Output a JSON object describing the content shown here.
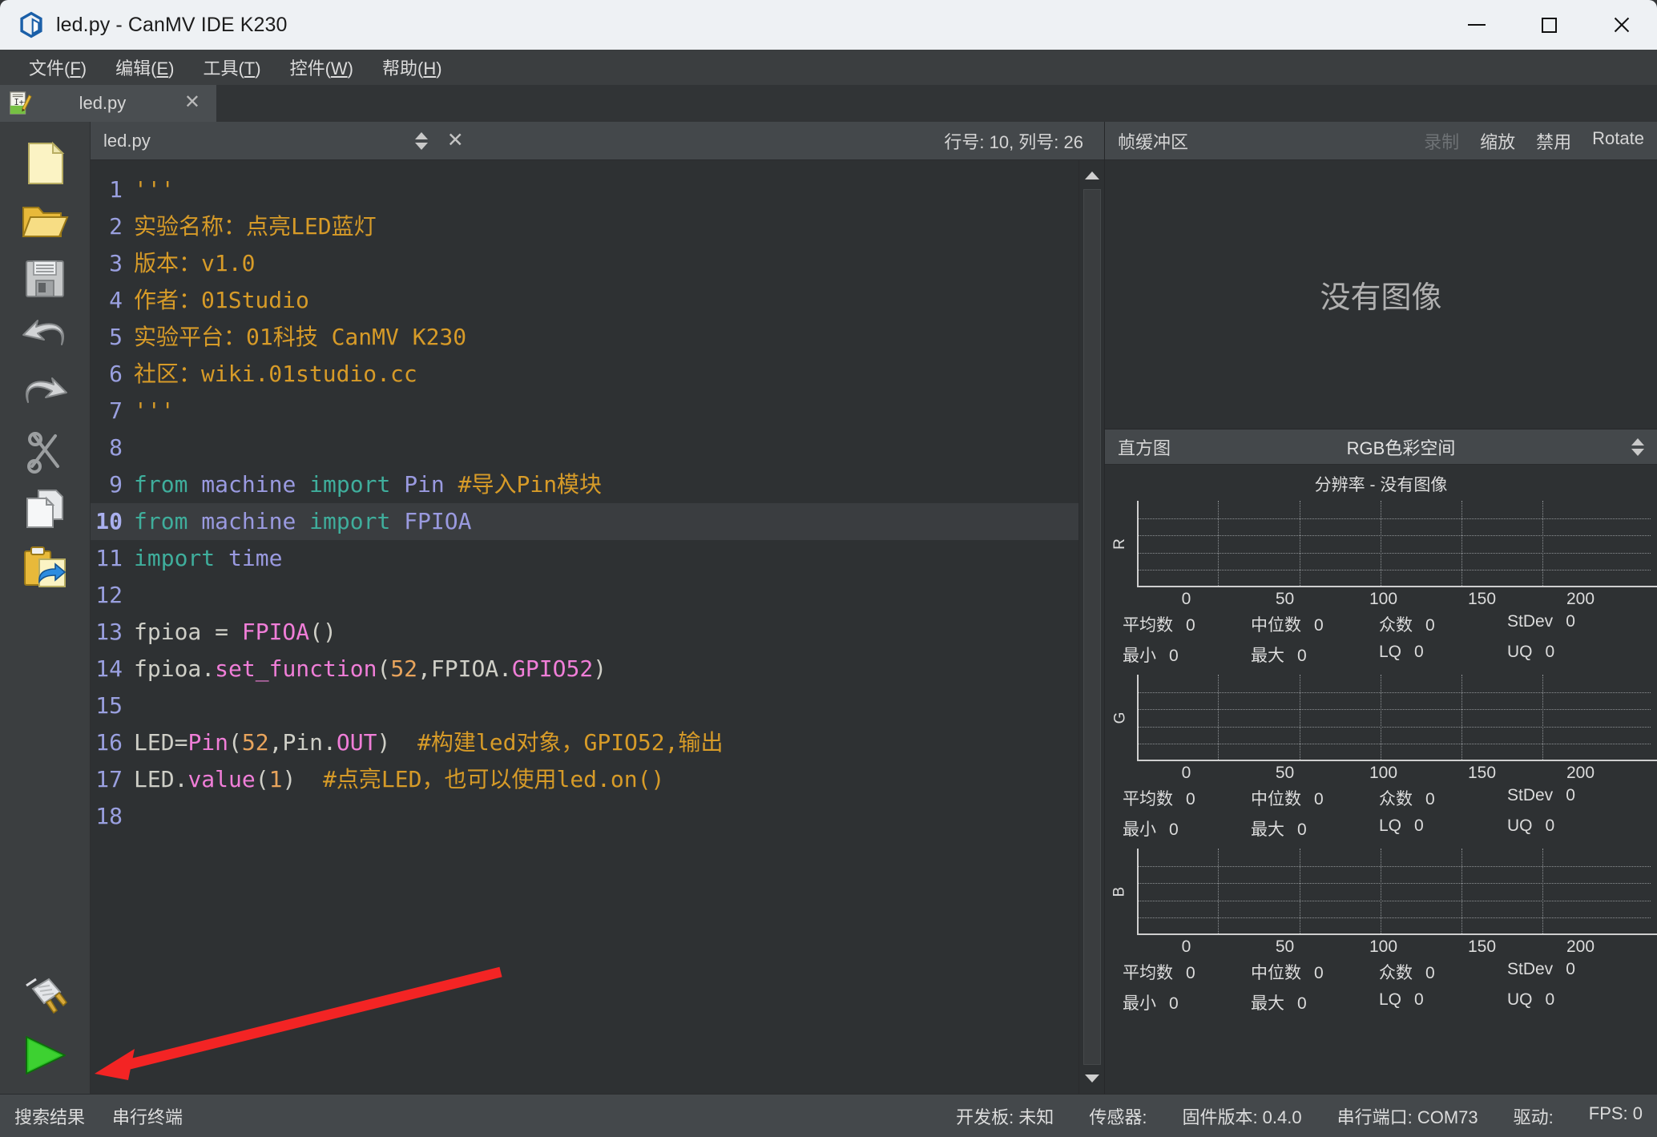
{
  "window": {
    "title": "led.py - CanMV IDE K230",
    "logo_icon": "canmv-hexagon-logo",
    "minimize_label": "minimize",
    "maximize_label": "maximize",
    "close_label": "close"
  },
  "menubar": {
    "items": [
      {
        "label": "文件",
        "accel": "F"
      },
      {
        "label": "编辑",
        "accel": "E"
      },
      {
        "label": "工具",
        "accel": "T"
      },
      {
        "label": "控件",
        "accel": "W"
      },
      {
        "label": "帮助",
        "accel": "H"
      }
    ]
  },
  "file_tabs": [
    {
      "label": "led.py",
      "icon": "python-file-icon",
      "close": "✕"
    }
  ],
  "left_toolbar": {
    "items": [
      {
        "name": "new-file",
        "icon": "new-file-icon"
      },
      {
        "name": "open-file",
        "icon": "open-folder-icon"
      },
      {
        "name": "save-file",
        "icon": "floppy-save-icon"
      },
      {
        "name": "undo",
        "icon": "undo-arrow-icon"
      },
      {
        "name": "redo",
        "icon": "redo-arrow-icon"
      },
      {
        "name": "cut",
        "icon": "scissors-icon"
      },
      {
        "name": "copy",
        "icon": "copy-pages-icon"
      },
      {
        "name": "paste",
        "icon": "paste-clipboard-icon"
      }
    ],
    "bottom_items": [
      {
        "name": "connect",
        "icon": "plug-connect-icon"
      },
      {
        "name": "run",
        "icon": "green-play-icon"
      }
    ]
  },
  "editor": {
    "filename": "led.py",
    "close": "✕",
    "cursor_position": "行号: 10, 列号: 26",
    "current_line": 10,
    "lines": [
      {
        "n": 1,
        "tokens": [
          {
            "t": "str",
            "s": "'''"
          }
        ]
      },
      {
        "n": 2,
        "tokens": [
          {
            "t": "str",
            "s": "实验名称：点亮LED蓝灯"
          }
        ]
      },
      {
        "n": 3,
        "tokens": [
          {
            "t": "str",
            "s": "版本：v1.0"
          }
        ]
      },
      {
        "n": 4,
        "tokens": [
          {
            "t": "str",
            "s": "作者：01Studio"
          }
        ]
      },
      {
        "n": 5,
        "tokens": [
          {
            "t": "str",
            "s": "实验平台：01科技 CanMV K230"
          }
        ]
      },
      {
        "n": 6,
        "tokens": [
          {
            "t": "str",
            "s": "社区：wiki.01studio.cc"
          }
        ]
      },
      {
        "n": 7,
        "tokens": [
          {
            "t": "str",
            "s": "'''"
          }
        ]
      },
      {
        "n": 8,
        "tokens": []
      },
      {
        "n": 9,
        "tokens": [
          {
            "t": "kw",
            "s": "from"
          },
          {
            "t": "pl",
            "s": " "
          },
          {
            "t": "id",
            "s": "machine"
          },
          {
            "t": "pl",
            "s": " "
          },
          {
            "t": "kw",
            "s": "import"
          },
          {
            "t": "pl",
            "s": " "
          },
          {
            "t": "id",
            "s": "Pin"
          },
          {
            "t": "pl",
            "s": " "
          },
          {
            "t": "com",
            "s": "#导入Pin模块"
          }
        ]
      },
      {
        "n": 10,
        "tokens": [
          {
            "t": "kw",
            "s": "from"
          },
          {
            "t": "pl",
            "s": " "
          },
          {
            "t": "id",
            "s": "machine"
          },
          {
            "t": "pl",
            "s": " "
          },
          {
            "t": "kw",
            "s": "import"
          },
          {
            "t": "pl",
            "s": " "
          },
          {
            "t": "id",
            "s": "FPIOA"
          }
        ]
      },
      {
        "n": 11,
        "tokens": [
          {
            "t": "kw",
            "s": "import"
          },
          {
            "t": "pl",
            "s": " "
          },
          {
            "t": "id",
            "s": "time"
          }
        ]
      },
      {
        "n": 12,
        "tokens": []
      },
      {
        "n": 13,
        "tokens": [
          {
            "t": "pl",
            "s": "fpioa = "
          },
          {
            "t": "fn",
            "s": "FPIOA"
          },
          {
            "t": "pl",
            "s": "()"
          }
        ]
      },
      {
        "n": 14,
        "tokens": [
          {
            "t": "pl",
            "s": "fpioa."
          },
          {
            "t": "fn",
            "s": "set_function"
          },
          {
            "t": "pl",
            "s": "("
          },
          {
            "t": "num",
            "s": "52"
          },
          {
            "t": "pl",
            "s": ",FPIOA."
          },
          {
            "t": "fn",
            "s": "GPIO52"
          },
          {
            "t": "pl",
            "s": ")"
          }
        ]
      },
      {
        "n": 15,
        "tokens": []
      },
      {
        "n": 16,
        "tokens": [
          {
            "t": "pl",
            "s": "LED="
          },
          {
            "t": "fn",
            "s": "Pin"
          },
          {
            "t": "pl",
            "s": "("
          },
          {
            "t": "num",
            "s": "52"
          },
          {
            "t": "pl",
            "s": ",Pin."
          },
          {
            "t": "fn",
            "s": "OUT"
          },
          {
            "t": "pl",
            "s": ")  "
          },
          {
            "t": "com",
            "s": "#构建led对象，GPIO52,输出"
          }
        ]
      },
      {
        "n": 17,
        "tokens": [
          {
            "t": "pl",
            "s": "LED."
          },
          {
            "t": "fn",
            "s": "value"
          },
          {
            "t": "pl",
            "s": "("
          },
          {
            "t": "num",
            "s": "1"
          },
          {
            "t": "pl",
            "s": ")  "
          },
          {
            "t": "com",
            "s": "#点亮LED，也可以使用led.on()"
          }
        ]
      },
      {
        "n": 18,
        "tokens": []
      }
    ]
  },
  "framebuffer": {
    "title": "帧缓冲区",
    "actions": [
      {
        "label": "录制",
        "enabled": false
      },
      {
        "label": "缩放",
        "enabled": true
      },
      {
        "label": "禁用",
        "enabled": true
      },
      {
        "label": "Rotate",
        "enabled": true
      }
    ],
    "no_image": "没有图像"
  },
  "histogram": {
    "title": "直方图",
    "colorspace": "RGB色彩空间",
    "resolution": "分辨率 - 没有图像",
    "stat_labels": {
      "mean": "平均数",
      "median": "中位数",
      "mode": "众数",
      "stdev": "StDev",
      "min": "最小",
      "max": "最大",
      "lq": "LQ",
      "uq": "UQ"
    },
    "channels": [
      {
        "name": "R",
        "mean": "0",
        "median": "0",
        "mode": "0",
        "stdev": "0",
        "min": "0",
        "max": "0",
        "lq": "0",
        "uq": "0"
      },
      {
        "name": "G",
        "mean": "0",
        "median": "0",
        "mode": "0",
        "stdev": "0",
        "min": "0",
        "max": "0",
        "lq": "0",
        "uq": "0"
      },
      {
        "name": "B",
        "mean": "0",
        "median": "0",
        "mode": "0",
        "stdev": "0",
        "min": "0",
        "max": "0",
        "lq": "0",
        "uq": "0"
      }
    ],
    "xticks": [
      "0",
      "50",
      "100",
      "150",
      "200"
    ]
  },
  "statusbar": {
    "tabs": [
      "搜索结果",
      "串行终端"
    ],
    "fields": [
      {
        "label": "开发板:",
        "value": "未知"
      },
      {
        "label": "传感器:",
        "value": ""
      },
      {
        "label": "固件版本:",
        "value": "0.4.0"
      },
      {
        "label": "串行端口:",
        "value": "COM73"
      },
      {
        "label": "驱动:",
        "value": ""
      },
      {
        "label": "FPS:",
        "value": "0"
      }
    ]
  },
  "annotation": {
    "arrow_color": "#f32424",
    "points_at": "run-button"
  },
  "colors": {
    "titlebar_bg": "#eef1f4",
    "chrome_bg": "#3b3e40",
    "editor_bg": "#2e3133",
    "panel_header_bg": "#44484b",
    "comment": "#d79b28",
    "keyword": "#3fae9c",
    "identifier": "#9a9ae0",
    "function": "#f07ed8",
    "number": "#e8a45c",
    "linenumber": "#9aa0e0"
  }
}
